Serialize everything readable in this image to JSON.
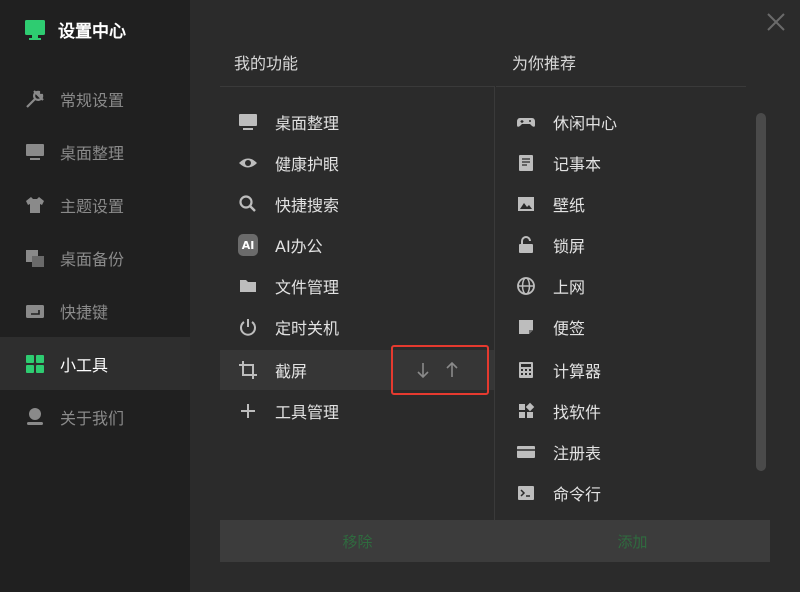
{
  "app": {
    "title": "设置中心",
    "brand_color": "#2ecc71"
  },
  "sidebar": {
    "items": [
      {
        "label": "常规设置",
        "icon": "wrench-icon"
      },
      {
        "label": "桌面整理",
        "icon": "monitor-icon"
      },
      {
        "label": "主题设置",
        "icon": "shirt-icon"
      },
      {
        "label": "桌面备份",
        "icon": "backup-icon"
      },
      {
        "label": "快捷键",
        "icon": "keyboard-icon"
      },
      {
        "label": "小工具",
        "icon": "grid-icon",
        "active": true
      },
      {
        "label": "关于我们",
        "icon": "user-icon"
      }
    ]
  },
  "my_functions": {
    "title": "我的功能",
    "items": [
      {
        "label": "桌面整理",
        "icon": "monitor-icon"
      },
      {
        "label": "健康护眼",
        "icon": "eye-icon"
      },
      {
        "label": "快捷搜索",
        "icon": "search-icon"
      },
      {
        "label": "AI办公",
        "icon": "ai-badge-icon",
        "badge": "AI"
      },
      {
        "label": "文件管理",
        "icon": "folder-icon"
      },
      {
        "label": "定时关机",
        "icon": "power-icon"
      },
      {
        "label": "截屏",
        "icon": "crop-icon",
        "selected": true
      },
      {
        "label": "工具管理",
        "icon": "plus-icon"
      }
    ]
  },
  "recommended": {
    "title": "为你推荐",
    "items": [
      {
        "label": "休闲中心",
        "icon": "gamepad-icon"
      },
      {
        "label": "记事本",
        "icon": "notepad-icon"
      },
      {
        "label": "壁纸",
        "icon": "image-icon"
      },
      {
        "label": "锁屏",
        "icon": "lock-icon"
      },
      {
        "label": "上网",
        "icon": "globe-icon"
      },
      {
        "label": "便签",
        "icon": "sticky-note-icon"
      },
      {
        "label": "计算器",
        "icon": "calculator-icon"
      },
      {
        "label": "找软件",
        "icon": "apps-icon"
      },
      {
        "label": "注册表",
        "icon": "registry-icon"
      },
      {
        "label": "命令行",
        "icon": "terminal-icon"
      }
    ]
  },
  "actions": {
    "remove_label": "移除",
    "add_label": "添加"
  },
  "colors": {
    "highlight_border": "#e53a2f",
    "action_text": "#2f6b3f"
  }
}
